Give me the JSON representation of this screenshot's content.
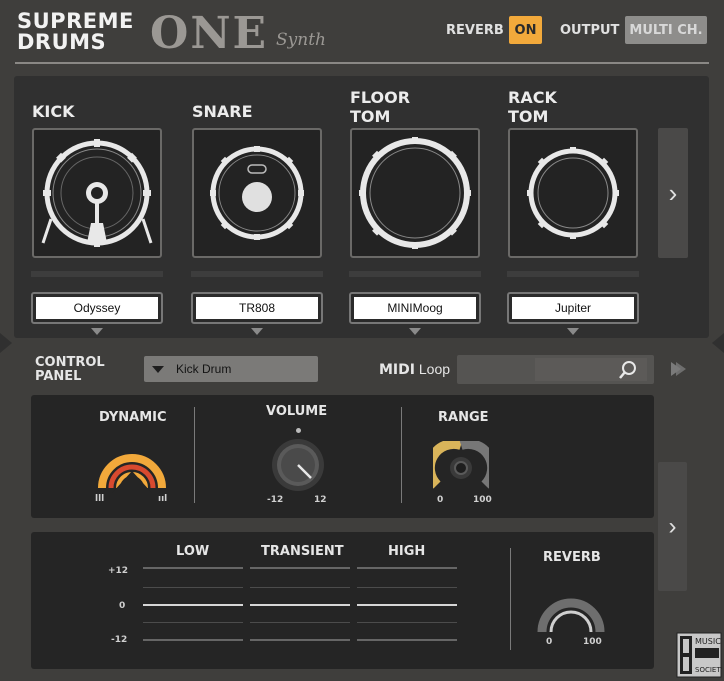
{
  "header": {
    "logo_line1": "SUPREME",
    "logo_line2": "DRUMS",
    "logo_one": "ONE",
    "logo_synth": "Synth",
    "reverb_label": "REVERB",
    "reverb_state": "ON",
    "output_label": "OUTPUT",
    "output_value": "MULTI CH."
  },
  "drums": [
    {
      "name_line1": "KICK",
      "name_line2": "",
      "preset": "Odyssey",
      "icon": "kick-drum-icon"
    },
    {
      "name_line1": "SNARE",
      "name_line2": "",
      "preset": "TR808",
      "icon": "snare-drum-icon"
    },
    {
      "name_line1": "FLOOR",
      "name_line2": "TOM",
      "preset": "MINIMoog",
      "icon": "floor-tom-icon"
    },
    {
      "name_line1": "RACK",
      "name_line2": "TOM",
      "preset": "Jupiter",
      "icon": "rack-tom-icon"
    }
  ],
  "control_panel": {
    "label_line1": "CONTROL",
    "label_line2": "PANEL",
    "selected": "Kick Drum",
    "midi_bold": "MIDI",
    "midi_rest": "Loop"
  },
  "knobs": {
    "dynamic": {
      "title": "DYNAMIC",
      "min": "lll",
      "max": "ııl"
    },
    "volume": {
      "title": "VOLUME",
      "min": "-12",
      "max": "12"
    },
    "range": {
      "title": "RANGE",
      "min": "0",
      "max": "100"
    }
  },
  "eq": {
    "bands": [
      "LOW",
      "TRANSIENT",
      "HIGH"
    ],
    "scale_top": "+12",
    "scale_mid": "0",
    "scale_bot": "-12",
    "reverb_title": "REVERB",
    "reverb_min": "0",
    "reverb_max": "100"
  },
  "watermark": {
    "line1": "MUSIC",
    "line2": "SOCIETY"
  },
  "colors": {
    "accent": "#f2a93b",
    "panel": "#303030",
    "background": "#3f3e3c"
  }
}
